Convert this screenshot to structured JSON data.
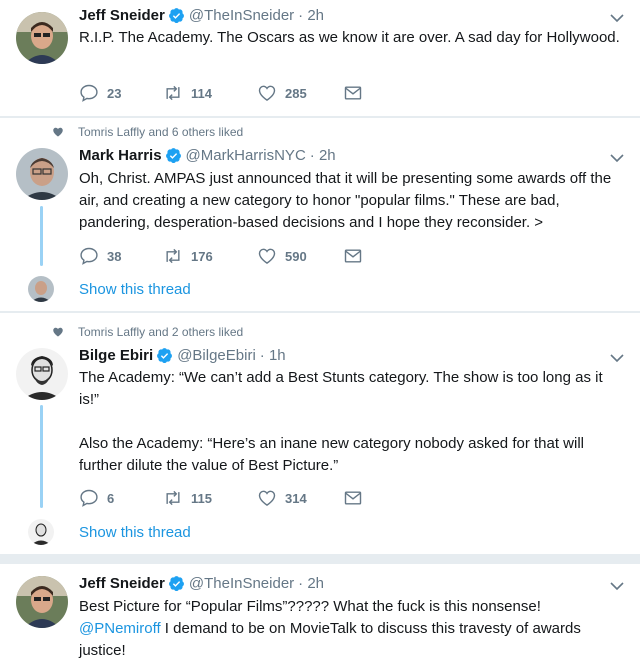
{
  "tweets": [
    {
      "social_context": "",
      "name": "Jeff Sneider",
      "handle": "@TheInSneider",
      "time": "· 2h",
      "paragraphs": [
        "R.I.P. The Academy. The Oscars as we know it are over. A sad day for Hollywood."
      ],
      "replies": "23",
      "retweets": "114",
      "likes": "285",
      "show_thread": ""
    },
    {
      "social_context": "Tomris Laffly and 6 others liked",
      "name": "Mark Harris",
      "handle": "@MarkHarrisNYC",
      "time": "· 2h",
      "paragraphs": [
        "Oh, Christ. AMPAS just announced that it will be presenting some awards off the air, and creating a new category to honor \"popular films.\" These are bad, pandering, desperation-based decisions and I hope they reconsider. >"
      ],
      "replies": "38",
      "retweets": "176",
      "likes": "590",
      "show_thread": "Show this thread"
    },
    {
      "social_context": "Tomris Laffly and 2 others liked",
      "name": "Bilge Ebiri",
      "handle": "@BilgeEbiri",
      "time": "· 1h",
      "paragraphs": [
        "The Academy: “We can’t add a Best Stunts category. The show is too long as it is!”",
        "Also the Academy: “Here’s an inane new category nobody asked for that will further dilute the value of Best Picture.”"
      ],
      "replies": "6",
      "retweets": "115",
      "likes": "314",
      "show_thread": "Show this thread"
    },
    {
      "social_context": "",
      "name": "Jeff Sneider",
      "handle": "@TheInSneider",
      "time": "· 2h",
      "paragraphs": [
        "Best Picture for “Popular Films”?????  What the fuck is this nonsense!"
      ],
      "mention": "@PNemiroff",
      "mention_rest": " I demand to be on MovieTalk to discuss this travesty of awards justice!",
      "replies": "",
      "retweets": "",
      "likes": "",
      "show_thread": ""
    }
  ],
  "colors": {
    "accent": "#1b95e0",
    "thread_line": "#9ad2f5",
    "secondary_text": "#657786",
    "separator": "#e6ecf0"
  },
  "icons": [
    "verified-badge-icon",
    "chevron-down-icon",
    "reply-icon",
    "retweet-icon",
    "heart-icon",
    "direct-message-icon"
  ]
}
